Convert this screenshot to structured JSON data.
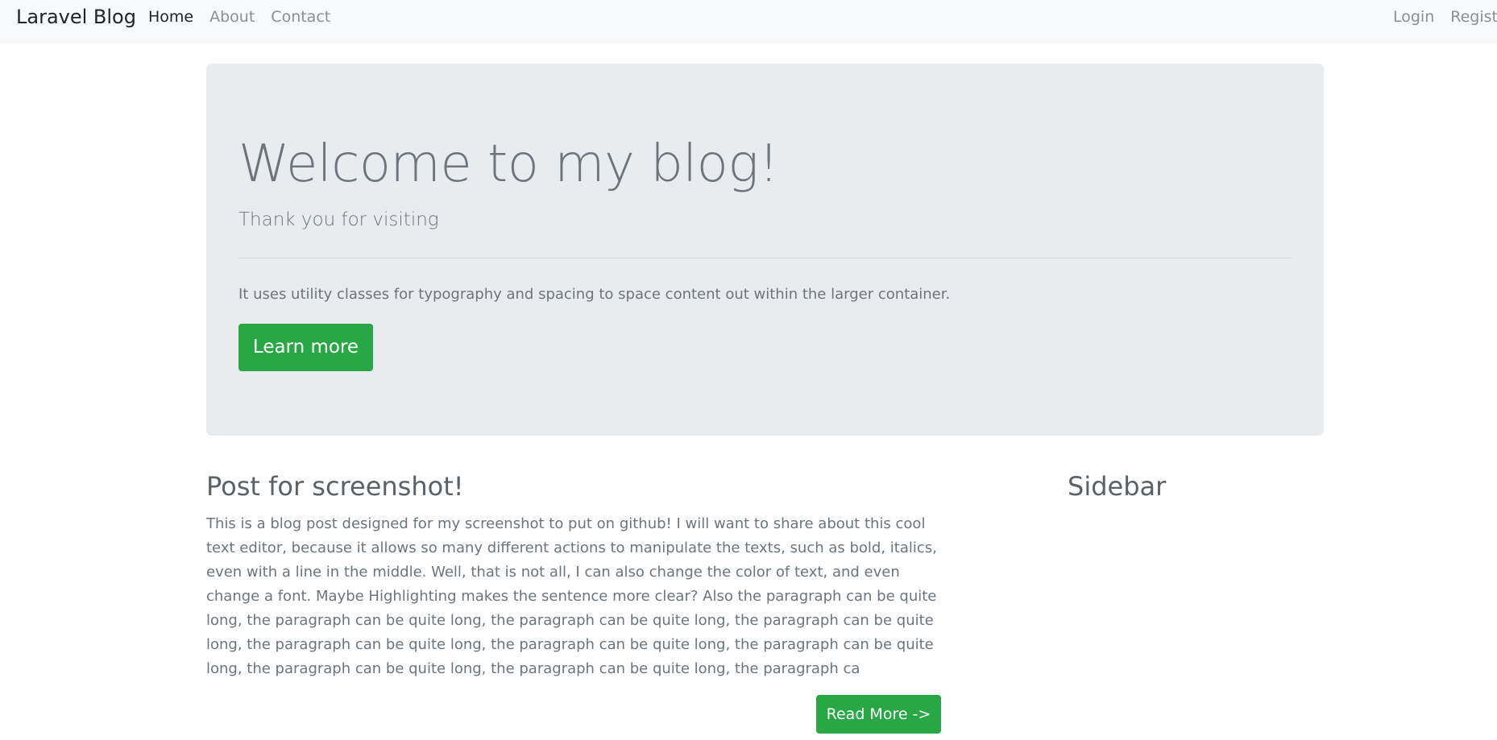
{
  "navbar": {
    "brand": "Laravel Blog",
    "links": [
      {
        "label": "Home",
        "active": true
      },
      {
        "label": "About",
        "active": false
      },
      {
        "label": "Contact",
        "active": false
      }
    ],
    "right_links": [
      {
        "label": "Login"
      },
      {
        "label": "Register"
      }
    ]
  },
  "jumbotron": {
    "title": "Welcome to my blog!",
    "lead": "Thank you for visiting",
    "text": "It uses utility classes for typography and spacing to space content out within the larger container.",
    "button_label": "Learn more"
  },
  "post": {
    "title": "Post for screenshot!",
    "body": "This is a blog post designed for my screenshot to put on github! I will want to share about this cool text editor, because it allows so many different actions to manipulate the texts, such as bold, italics, even with a line in the middle. Well, that is not all, I can also change the color of text, and even change a font.  Maybe Highlighting makes the sentence more clear? Also the paragraph can be quite long, the paragraph can be quite long, the paragraph can be quite long, the paragraph can be quite long, the paragraph can be quite long, the paragraph can be quite long, the paragraph can be quite long, the paragraph can be quite long, the paragraph can be quite long, the paragraph ca",
    "read_more_label": "Read More ->"
  },
  "sidebar": {
    "title": "Sidebar"
  },
  "colors": {
    "accent_green": "#28a745",
    "jumbotron_bg": "#e9ecef",
    "navbar_bg": "#f8f9fa",
    "muted_text": "#6c757d"
  }
}
